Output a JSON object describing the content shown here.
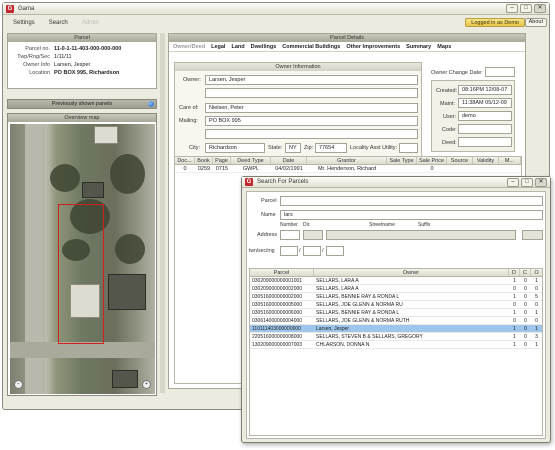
{
  "window": {
    "title": "Gama"
  },
  "menu": {
    "items": [
      "Settings",
      "Search",
      "Admin"
    ],
    "logged_in": "Logged in as Demo",
    "about": "About"
  },
  "parcel_panel": {
    "title": "Parcel",
    "fields": [
      {
        "label": "Parcel no.",
        "value": "11-0-1-11-403-000-000-000",
        "bold": true
      },
      {
        "label": "Twp/Rng/Sec",
        "value": "1/11/11",
        "bold": false
      },
      {
        "label": "Owner Info",
        "value": "Larsen, Jesper",
        "bold": false
      },
      {
        "label": "Location",
        "value": "PO BOX 995, Richardson",
        "bold": true
      }
    ]
  },
  "previous_panels": {
    "label": "Previously shown panels"
  },
  "overview_map": {
    "title": "Overview map"
  },
  "details": {
    "title": "Parcel Details",
    "tabs": [
      "Owner/Deed",
      "Legal",
      "Land",
      "Dwellings",
      "Commercial Buildings",
      "Other Improvements",
      "Summary",
      "Maps"
    ],
    "owner_info": {
      "title": "Owner Information",
      "owner_label": "Owner:",
      "owner": "Larsen, Jesper",
      "owner2": "",
      "careof_label": "Care of:",
      "careof": "Nielsen, Peter",
      "mailing_label": "Mailing:",
      "mailing": "PO BOX 995",
      "mailing2": "",
      "city_label": "City:",
      "city": "Richardson",
      "state_label": "State:",
      "state": "NY",
      "zip_label": "Zip:",
      "zip": "77654",
      "utility_label": "Locality Asst Utility:",
      "utility": ""
    },
    "owner_change_label": "Owner Change Date:",
    "meta": [
      {
        "label": "Created:",
        "value": "08:16PM 12/08-07"
      },
      {
        "label": "Maint:",
        "value": "11:38AM 05/12-09"
      },
      {
        "label": "User:",
        "value": "demo"
      },
      {
        "label": "Code:",
        "value": ""
      },
      {
        "label": "Deed:",
        "value": ""
      }
    ],
    "deed_columns": [
      "Doc...",
      "Book",
      "Page",
      "Deed Type",
      "Date",
      "Grantor",
      "Sale Type",
      "Sale Price",
      "Source",
      "Validity",
      "M..."
    ],
    "deed_rows": [
      [
        "0",
        "0259",
        "0715",
        "GWPL",
        "04/02/1991",
        "Mr. Henderson, Richard",
        "",
        "0",
        "",
        "",
        ""
      ]
    ]
  },
  "search_dialog": {
    "title": "Search For Parcels",
    "parcel_label": "Parcel",
    "parcel": "",
    "name_label": "Name",
    "name": "lars",
    "address_label": "Address",
    "number_label": "Number",
    "dir_label": "Dir.",
    "street_label": "Streetname",
    "suffix_label": "Suffix",
    "twp_label": "twn/sec/rng",
    "columns": [
      "Parcel",
      "Owner",
      "D",
      "C",
      "O"
    ],
    "rows": [
      {
        "parcel": "030209000000001001",
        "owner": "SELLARS, LARA A",
        "d": "1",
        "c": "0",
        "o": "1",
        "selected": false
      },
      {
        "parcel": "030209000000002000",
        "owner": "SELLARS, LARA A",
        "d": "0",
        "c": "0",
        "o": "0",
        "selected": false
      },
      {
        "parcel": "030516000000002000",
        "owner": "SELLARS, BENNIE RAY & RONDA L",
        "d": "1",
        "c": "0",
        "o": "5",
        "selected": false
      },
      {
        "parcel": "030516000000005000",
        "owner": "SELLARS, JOE GLENN & NORMA RU",
        "d": "0",
        "c": "0",
        "o": "0",
        "selected": false
      },
      {
        "parcel": "030516000000006000",
        "owner": "SELLARS, BENNIE RAY & RONDA L",
        "d": "1",
        "c": "0",
        "o": "1",
        "selected": false
      },
      {
        "parcel": "030614000000004000",
        "owner": "SELLARS, JOE GLENN & NORMA RUTH",
        "d": "0",
        "c": "0",
        "o": "0",
        "selected": false
      },
      {
        "parcel": "110111403000000000",
        "owner": "Larsen, Jesper",
        "d": "1",
        "c": "0",
        "o": "1",
        "selected": true
      },
      {
        "parcel": "220516000000008000",
        "owner": "SELLARS, STEVEN B & SELLARS, GREGORY",
        "d": "1",
        "c": "0",
        "o": "3",
        "selected": false
      },
      {
        "parcel": "130209000000007003",
        "owner": "CHLARSON, DONNA N",
        "d": "1",
        "c": "0",
        "o": "1",
        "selected": false
      }
    ]
  },
  "colors": {
    "accent": "#e9c649",
    "selection": "#9ec6ec",
    "app_icon": "#c0282d"
  }
}
